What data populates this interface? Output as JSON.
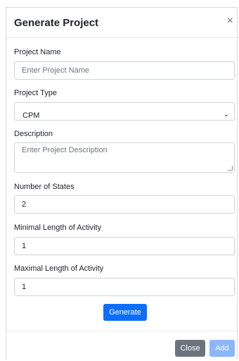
{
  "modal": {
    "title": "Generate Project",
    "close_icon": "×"
  },
  "form": {
    "project_name": {
      "label": "Project Name",
      "placeholder": "Enter Project Name",
      "value": ""
    },
    "project_type": {
      "label": "Project Type",
      "value": "CPM"
    },
    "description": {
      "label": "Description",
      "placeholder": "Enter Project Description",
      "value": ""
    },
    "number_of_states": {
      "label": "Number of States",
      "value": "2"
    },
    "minimal_length": {
      "label": "Minimal Length of Activity",
      "value": "1"
    },
    "maximal_length": {
      "label": "Maximal Length of Activity",
      "value": "1"
    }
  },
  "buttons": {
    "generate": "Generate",
    "close": "Close",
    "add": "Add"
  },
  "icons": {
    "close": "close-icon",
    "select": "chevron-down-icon",
    "resize": "resize-grip-icon"
  },
  "colors": {
    "primary": "#0d6efd",
    "primary_disabled": "#8bb6fb",
    "secondary": "#6c757d"
  }
}
